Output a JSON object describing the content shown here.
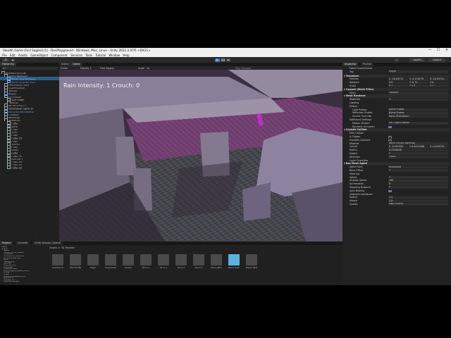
{
  "window": {
    "title": "Stealth Game (For) Sagiled (1) - DevPlayground - Windows, Mac, Linux - Unity 2022.3.47f1 <DX11>",
    "controls": [
      "—",
      "☐",
      "✕"
    ]
  },
  "menu": [
    "File",
    "Edit",
    "Assets",
    "GameObject",
    "Component",
    "Services",
    "Tools",
    "Tutorial",
    "Window",
    "Help"
  ],
  "toolbar": {
    "account": "AI",
    "layers_label": "Layers",
    "layout_label": "Layout"
  },
  "hierarchy": {
    "tab": "Hierarchy",
    "search_placeholder": "All",
    "items": [
      {
        "label": "DevPlayground*",
        "indent": 0,
        "type": "scene"
      },
      {
        "label": "Game Manager",
        "indent": 1
      },
      {
        "label": "Patrol Guard(Clone)",
        "indent": 2,
        "selected": true,
        "blue": true
      },
      {
        "label": "Patrol Guard(Clone)",
        "indent": 2,
        "blue": true
      },
      {
        "label": "Directional Light",
        "indent": 1
      },
      {
        "label": "EventSystem",
        "indent": 1
      },
      {
        "label": "Terrain",
        "indent": 1
      },
      {
        "label": "Player",
        "indent": 1,
        "blue": true
      },
      {
        "label": "UI Canvas",
        "indent": 1
      },
      {
        "label": "Text (TMP)",
        "indent": 2
      },
      {
        "label": "Panel",
        "indent": 2
      },
      {
        "label": "FP Structure 1",
        "indent": 1
      },
      {
        "label": "Directional Light (1)",
        "indent": 1
      },
      {
        "label": "Blocking Wall Prefab",
        "indent": 1,
        "blue": true
      },
      {
        "label": "Lighting",
        "indent": 1
      },
      {
        "label": "Materials",
        "indent": 1
      },
      {
        "label": "AI Patrols",
        "indent": 1
      },
      {
        "label": "Cube",
        "indent": 2
      },
      {
        "label": "Brick",
        "indent": 2
      },
      {
        "label": "Cube",
        "indent": 2
      },
      {
        "label": "Arch",
        "indent": 2
      },
      {
        "label": "Cube",
        "indent": 2
      },
      {
        "label": "Cube (1)",
        "indent": 2
      },
      {
        "label": "Cube",
        "indent": 2
      },
      {
        "label": "Tunnel",
        "indent": 2
      },
      {
        "label": "Cube",
        "indent": 2
      },
      {
        "label": "Stairs",
        "indent": 2
      },
      {
        "label": "Cube",
        "indent": 2
      },
      {
        "label": "Cube (2)",
        "indent": 2
      },
      {
        "label": "Ground 1",
        "indent": 2
      },
      {
        "label": "Cube (3)",
        "indent": 2
      },
      {
        "label": "Cube (1)",
        "indent": 2
      },
      {
        "label": "Cube (2)",
        "indent": 2
      }
    ]
  },
  "scene": {
    "tabs": [
      "Scene",
      "Game"
    ],
    "display": "Game",
    "display_num": "Display 1",
    "aspect": "Free Aspect",
    "scale_label": "Scale",
    "scale_value": "1x",
    "play_focused": "Play Focused",
    "overlay_text": "Rain Intensity: 1 Crouch: 0"
  },
  "project": {
    "tabs": [
      "Project",
      "Console",
      "Unity Version Control"
    ],
    "breadcrumb": "Assets > 3D Meshes",
    "folders": [
      "Assets",
      "Scripts",
      "Assets",
      "frames_conflict_lowpoly",
      "3D Meshes",
      "3LE Low Poly Cloud Pack",
      "Blockcade Labs SDK",
      "Demo",
      "FreeHightSky",
      "Materials",
      "Particles & VFX",
      "PBoysMats",
      "ProBuilder Data",
      "RPG_FPS_game_assets_industr",
      "Scenes",
      "Scripts",
      "SimpleCloudSystem by RF",
      "Sprites & UI",
      "TextMesh Pro",
      "Unity Technologies"
    ],
    "assets": [
      "Low Poly Char",
      "ORnVtrd Bk",
      "Eagle",
      "fragmental",
      "fence1",
      "fence 1",
      "fence 1",
      "fence 2",
      "fence 3",
      "Fence_BuildMat",
      "Patrol Guard",
      "Player Mesh"
    ]
  },
  "inspector": {
    "tabs": [
      "Inspector",
      "Profiler"
    ],
    "object_name": "Patrol Guard(Clone)",
    "static_label": "Static",
    "tag_label": "Tag",
    "tag": "Player",
    "layer_label": "Layer",
    "layer": "PhysicalVisibleMesh",
    "transform": {
      "header": "Transform",
      "position_label": "Position",
      "position": [
        "X -18.03174",
        "Y -0.120276",
        "Z -18.03752"
      ],
      "rotation_label": "Rotation",
      "rotation": [
        "X 0",
        "Y -0.72",
        "Z 0"
      ],
      "scale_label": "Scale",
      "scale": [
        "X 1",
        "Y 1.5",
        "Z 1"
      ]
    },
    "mesh_filter": {
      "header": "Capsule (Mesh Filter)",
      "mesh_label": "Mesh",
      "mesh": "Capsule"
    },
    "mesh_renderer": {
      "header": "Mesh Renderer",
      "materials_label": "Materials",
      "materials_count": "1",
      "lighting": "Lighting",
      "probes": "Probes",
      "light_probes_label": "Light Probes",
      "light_probes": "Blend Probes",
      "reflection_probes_label": "Reflection Probes",
      "reflection_probes": "Blend Probes",
      "anchor_override_label": "Anchor Override",
      "anchor_override": "None (Transform)",
      "additional": "Additional Settings",
      "motion_vectors_label": "Motion Vectors",
      "motion_vectors": "Per Object Motion",
      "dynamic_occlusion_label": "Dynamic Occlusion"
    },
    "capsule_collider": {
      "header": "Capsule Collider",
      "edit_label": "Edit Collider",
      "is_trigger": "Is Trigger",
      "provides_contacts": "Provides Contacts",
      "material_label": "Material",
      "material": "None (Physic Material)",
      "center_label": "Center",
      "center": [
        "X -0.007995",
        "Y 0.0432988",
        "Z -0.028729"
      ],
      "radius_label": "Radius",
      "radius": "0.4708006",
      "height_label": "Height",
      "height": "2",
      "direction_label": "Direction",
      "direction": "Y-Axis",
      "layer_overrides": "Layer Overrides"
    },
    "nav_mesh_agent": {
      "header": "Nav Mesh Agent",
      "agent_type_label": "Agent Type",
      "agent_type": "Humanoid",
      "base_offset_label": "Base Offset",
      "base_offset": "1",
      "steering": "Steering",
      "speed_label": "Speed",
      "speed": "3",
      "angular_speed_label": "Angular Speed",
      "angular_speed": "180",
      "acceleration_label": "Acceleration",
      "acceleration": "8",
      "stopping_distance_label": "Stopping Distance",
      "stopping_distance": "0",
      "auto_braking_label": "Auto Braking",
      "obstacle": "Obstacle Avoidance",
      "oa_radius_label": "Radius",
      "oa_radius": "1.2",
      "oa_height_label": "Height",
      "oa_height": "1.8",
      "quality_label": "Quality",
      "quality": "High Quality"
    }
  }
}
